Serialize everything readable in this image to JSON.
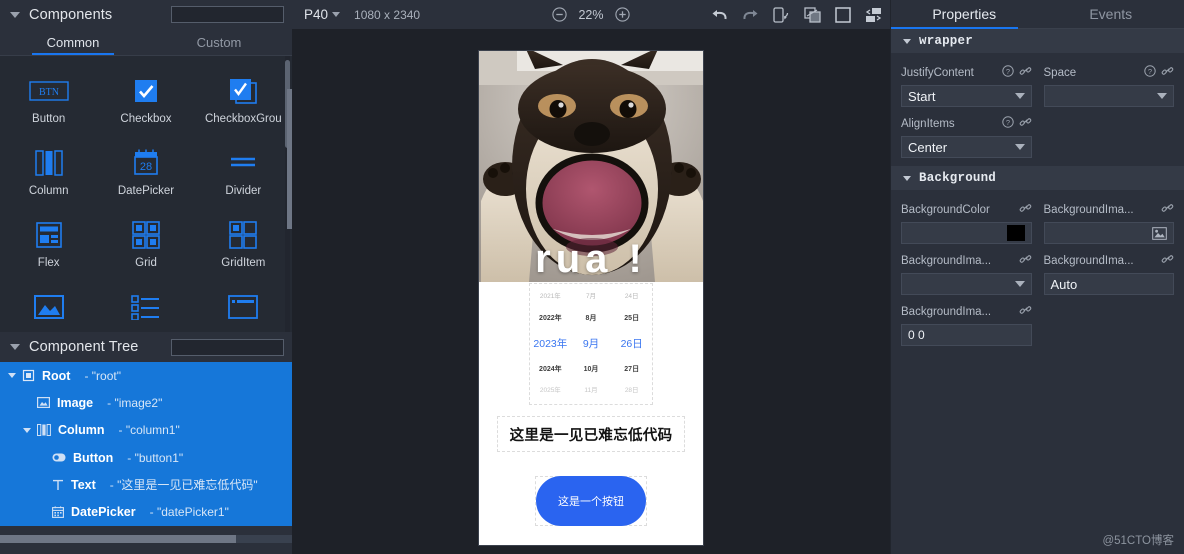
{
  "components_panel": {
    "title": "Components",
    "caret_icon": "caret-down-icon",
    "search": {
      "value": "",
      "placeholder": "",
      "icon": "search-icon"
    },
    "tabs": [
      {
        "label": "Common",
        "active": true
      },
      {
        "label": "Custom",
        "active": false
      }
    ],
    "items": [
      {
        "label": "Button",
        "icon": "button-icon"
      },
      {
        "label": "Checkbox",
        "icon": "checkbox-icon"
      },
      {
        "label": "CheckboxGrou",
        "icon": "checkbox-group-icon"
      },
      {
        "label": "Column",
        "icon": "column-icon"
      },
      {
        "label": "DatePicker",
        "icon": "datepicker-icon"
      },
      {
        "label": "Divider",
        "icon": "divider-icon"
      },
      {
        "label": "Flex",
        "icon": "flex-icon"
      },
      {
        "label": "Grid",
        "icon": "grid-icon"
      },
      {
        "label": "GridItem",
        "icon": "griditem-icon"
      },
      {
        "label": "",
        "icon": "image-icon"
      },
      {
        "label": "",
        "icon": "list-icon"
      },
      {
        "label": "",
        "icon": "panel-icon"
      }
    ]
  },
  "component_tree": {
    "title": "Component Tree",
    "caret_icon": "caret-down-icon",
    "search": {
      "value": "",
      "placeholder": "",
      "icon": "search-icon"
    },
    "nodes": [
      {
        "name": "Root",
        "id": "- \"root\"",
        "icon": "root-icon",
        "indent": 0,
        "expanded": true
      },
      {
        "name": "Image",
        "id": "- \"image2\"",
        "icon": "image-icon",
        "indent": 1,
        "expanded": null
      },
      {
        "name": "Column",
        "id": "- \"column1\"",
        "icon": "column-icon",
        "indent": 1,
        "expanded": true
      },
      {
        "name": "Button",
        "id": "- \"button1\"",
        "icon": "button-icon",
        "indent": 2,
        "expanded": null
      },
      {
        "name": "Text",
        "id": "- \"这里是一见已难忘低代码\"",
        "icon": "text-icon",
        "indent": 2,
        "expanded": null
      },
      {
        "name": "DatePicker",
        "id": "- \"datePicker1\"",
        "icon": "datepicker-icon",
        "indent": 2,
        "expanded": null
      }
    ]
  },
  "toolbar": {
    "device_name": "P40",
    "device_chevron_icon": "chevron-down-icon",
    "resolution": "1080 x 2340",
    "zoom_out_icon": "zoom-out-icon",
    "zoom_value": "22%",
    "zoom_in_icon": "zoom-in-icon",
    "actions": [
      {
        "icon": "undo-icon"
      },
      {
        "icon": "redo-icon"
      },
      {
        "icon": "device-rotate-icon"
      },
      {
        "icon": "layers-icon"
      },
      {
        "icon": "frame-icon"
      },
      {
        "icon": "swap-panel-icon"
      }
    ]
  },
  "preview": {
    "image": {
      "overlay_text": "rua !",
      "alt": "shiba-inu-dog-image"
    },
    "datepicker": {
      "rows": [
        {
          "year": "2021年",
          "month": "7月",
          "day": "24日",
          "state": "far"
        },
        {
          "year": "2022年",
          "month": "8月",
          "day": "25日",
          "state": "near"
        },
        {
          "year": "2023年",
          "month": "9月",
          "day": "26日",
          "state": "selected"
        },
        {
          "year": "2024年",
          "month": "10月",
          "day": "27日",
          "state": "near"
        },
        {
          "year": "2025年",
          "month": "11月",
          "day": "28日",
          "state": "far"
        }
      ],
      "selected_color": "#3a76f0"
    },
    "text": "这里是一见已难忘低代码",
    "button": {
      "label": "这是一个按钮",
      "color": "#2a64f0"
    }
  },
  "properties_panel": {
    "tabs": [
      {
        "label": "Properties",
        "active": true
      },
      {
        "label": "Events",
        "active": false
      }
    ],
    "sections": [
      {
        "title": "wrapper",
        "caret_icon": "caret-down-icon",
        "fields": [
          {
            "label": "JustifyContent",
            "value": "Start",
            "type": "select",
            "help_icon": "help-icon",
            "link_icon": "link-icon"
          },
          {
            "label": "Space",
            "value": "",
            "type": "select",
            "help_icon": "help-icon",
            "link_icon": "link-icon"
          },
          {
            "label": "AlignItems",
            "value": "Center",
            "type": "select",
            "help_icon": "help-icon",
            "link_icon": "link-icon"
          }
        ]
      },
      {
        "title": "Background",
        "caret_icon": "caret-down-icon",
        "fields": [
          {
            "label": "BackgroundColor",
            "value": "",
            "type": "color",
            "color": "#000000",
            "link_icon": "link-icon"
          },
          {
            "label": "BackgroundIma...",
            "value": "",
            "type": "image",
            "image_icon": "picture-icon",
            "link_icon": "link-icon"
          },
          {
            "label": "BackgroundIma...",
            "value": "",
            "type": "select",
            "link_icon": "link-icon"
          },
          {
            "label": "BackgroundIma...",
            "value": "Auto",
            "type": "text",
            "link_icon": "link-icon"
          },
          {
            "label": "BackgroundIma...",
            "value": "0 0",
            "type": "text",
            "link_icon": "link-icon"
          }
        ]
      }
    ]
  },
  "watermark": "@51CTO博客"
}
